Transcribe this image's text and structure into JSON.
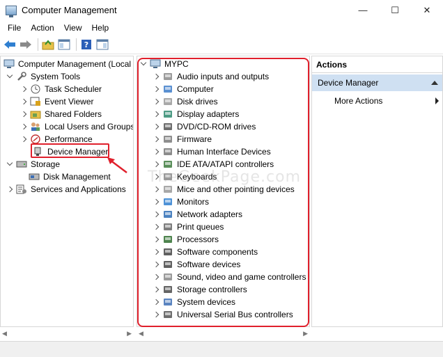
{
  "window": {
    "title": "Computer Management",
    "minimize": "—",
    "maximize": "☐",
    "close": "✕"
  },
  "menu": [
    "File",
    "Action",
    "View",
    "Help"
  ],
  "tree": {
    "root": "Computer Management (Local",
    "system_tools": "System Tools",
    "task_scheduler": "Task Scheduler",
    "event_viewer": "Event Viewer",
    "shared_folders": "Shared Folders",
    "local_users": "Local Users and Groups",
    "performance": "Performance",
    "device_manager": "Device Manager",
    "storage": "Storage",
    "disk_management": "Disk Management",
    "services": "Services and Applications"
  },
  "devices": {
    "root": "MYPC",
    "items": [
      "Audio inputs and outputs",
      "Computer",
      "Disk drives",
      "Display adapters",
      "DVD/CD-ROM drives",
      "Firmware",
      "Human Interface Devices",
      "IDE ATA/ATAPI controllers",
      "Keyboards",
      "Mice and other pointing devices",
      "Monitors",
      "Network adapters",
      "Print queues",
      "Processors",
      "Software components",
      "Software devices",
      "Sound, video and game controllers",
      "Storage controllers",
      "System devices",
      "Universal Serial Bus controllers"
    ]
  },
  "actions": {
    "header": "Actions",
    "selected": "Device Manager",
    "more": "More Actions"
  },
  "watermark": "TheGeekPage.com",
  "colors": {
    "highlight": "#e0202c",
    "selection": "#cfe0f2",
    "accent": "#1e6fd9"
  }
}
